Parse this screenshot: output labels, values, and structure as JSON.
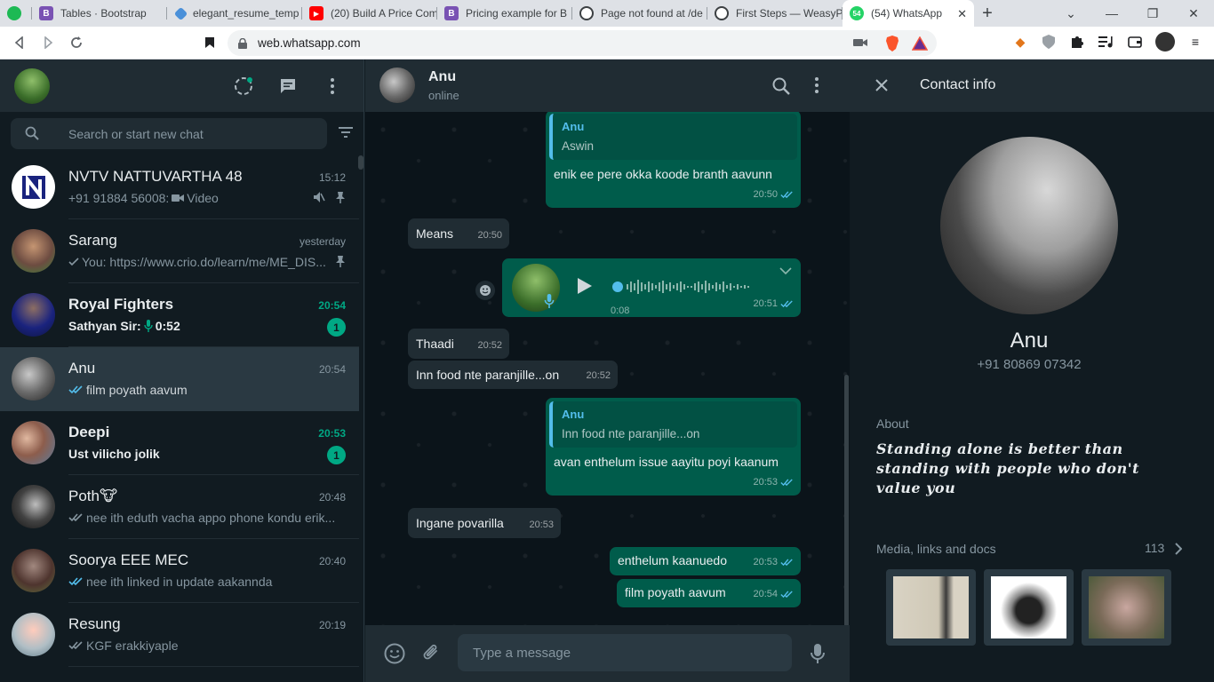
{
  "browser": {
    "tabs": [
      {
        "label": "",
        "color": "#1db954",
        "glyph": ""
      },
      {
        "label": "Tables · Bootstrap",
        "color": "#7952b3",
        "glyph": "B"
      },
      {
        "label": "elegant_resume_temp",
        "color": "#4a90d9",
        "glyph": ""
      },
      {
        "label": "(20) Build A Price Com",
        "color": "#ff0000",
        "glyph": "▶"
      },
      {
        "label": "Pricing example for B",
        "color": "#7952b3",
        "glyph": "B"
      },
      {
        "label": "Page not found at /de",
        "color": "#3c4043",
        "glyph": ""
      },
      {
        "label": "First Steps — WeasyP",
        "color": "#3c4043",
        "glyph": ""
      },
      {
        "label": "(54) WhatsApp",
        "color": "#25d366",
        "glyph": "54"
      }
    ],
    "url": "web.whatsapp.com"
  },
  "sidebar": {
    "search_placeholder": "Search or start new chat",
    "chats": [
      {
        "name": "NVTV NATTUVARTHA 48",
        "time": "15:12",
        "preview": "+91 91884 56008: ",
        "preview_extra": "Video",
        "unread": "",
        "bold": false,
        "avatar_color": "#1a237e"
      },
      {
        "name": "Sarang",
        "time": "yesterday",
        "preview": "You: https://www.crio.do/learn/me/ME_DIS...",
        "preview_extra": "",
        "unread": "",
        "bold": false,
        "avatar_color": "#5d4037"
      },
      {
        "name": "Royal  Fighters",
        "time": "20:54",
        "preview": "Sathyan Sir: ",
        "preview_extra": "0:52",
        "unread": "1",
        "bold": true,
        "avatar_color": "#283593"
      },
      {
        "name": "Anu",
        "time": "20:54",
        "preview": "film poyath aavum",
        "preview_extra": "",
        "unread": "",
        "bold": false,
        "avatar_color": "#555"
      },
      {
        "name": "Deepi",
        "time": "20:53",
        "preview": "Ust vilicho jolik",
        "preview_extra": "",
        "unread": "1",
        "bold": true,
        "avatar_color": "#6d4c41"
      },
      {
        "name": "Poth🐮",
        "time": "20:48",
        "preview": "nee ith eduth vacha appo phone kondu erik...",
        "preview_extra": "",
        "unread": "",
        "bold": false,
        "avatar_color": "#222"
      },
      {
        "name": "Soorya EEE MEC",
        "time": "20:40",
        "preview": "nee ith linked in update aakannda",
        "preview_extra": "",
        "unread": "",
        "bold": false,
        "avatar_color": "#3e2723"
      },
      {
        "name": "Resung",
        "time": "20:19",
        "preview": "KGF erakkiyaple",
        "preview_extra": "",
        "unread": "",
        "bold": false,
        "avatar_color": "#b0bec5"
      }
    ]
  },
  "conversation": {
    "contact_name": "Anu",
    "status": "online",
    "input_placeholder": "Type a message",
    "messages": {
      "m1": {
        "quote_name": "Anu",
        "quote_text": "Aswin",
        "text": "enik ee pere okka koode branth aavunn",
        "time": "20:50"
      },
      "m2": {
        "text": "Means",
        "time": "20:50"
      },
      "m3": {
        "duration": "0:08",
        "time": "20:51"
      },
      "m4": {
        "text": "Thaadi",
        "time": "20:52"
      },
      "m5": {
        "text": "Inn food nte paranjille...on",
        "time": "20:52"
      },
      "m6": {
        "quote_name": "Anu",
        "quote_text": "Inn food nte paranjille...on",
        "text": "avan enthelum issue aayitu poyi kaanum",
        "time": "20:53"
      },
      "m7": {
        "text": "Ingane povarilla",
        "time": "20:53"
      },
      "m8": {
        "text": "enthelum kaanuedo",
        "time": "20:53"
      },
      "m9": {
        "text": "film poyath aavum",
        "time": "20:54"
      }
    }
  },
  "contact_info": {
    "title": "Contact info",
    "name": "Anu",
    "phone": "+91 80869 07342",
    "about_label": "About",
    "about_text": "Standing alone is better than standing with people who don't value you",
    "media_label": "Media, links and docs",
    "media_count": "113"
  },
  "colors": {
    "accent": "#00a884",
    "outgoing_bubble": "#005c4b",
    "incoming_bubble": "#202c33",
    "tick_blue": "#53bdeb"
  }
}
